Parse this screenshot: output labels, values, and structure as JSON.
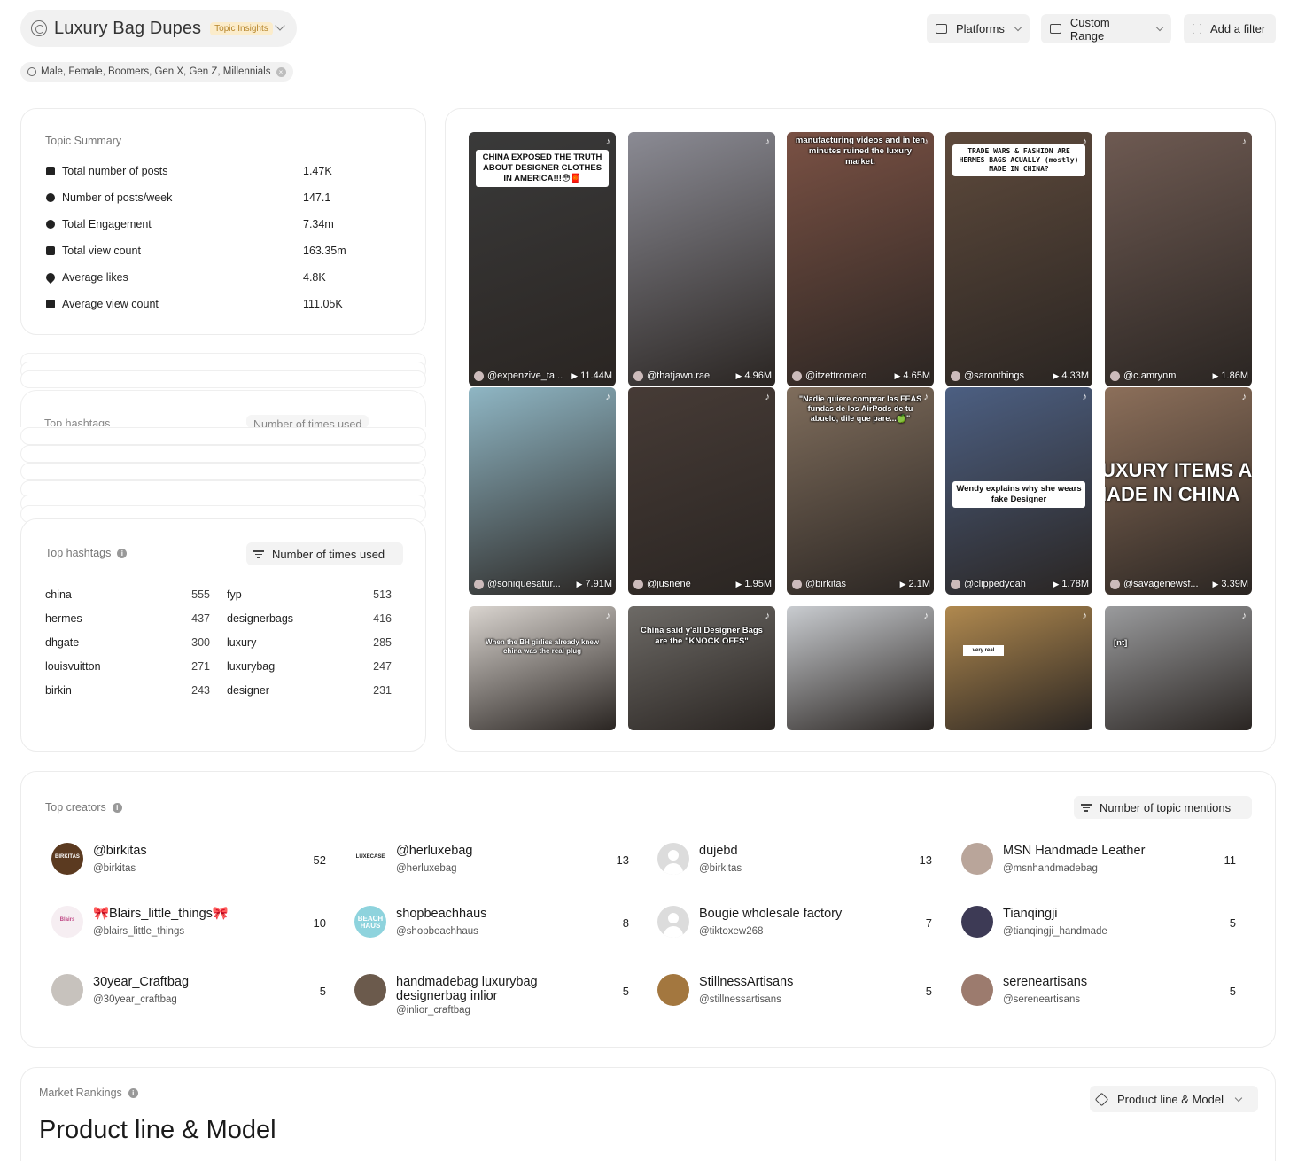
{
  "header": {
    "topic_title": "Luxury Bag Dupes",
    "topic_badge": "Topic Insights",
    "demographics": "Male, Female, Boomers, Gen X, Gen Z, Millennials",
    "buttons": {
      "platforms": "Platforms",
      "range": "Custom Range",
      "filter": "Add a filter"
    }
  },
  "summary": {
    "label": "Topic Summary",
    "rows": [
      {
        "label": "Total number of posts",
        "value": "1.47K"
      },
      {
        "label": "Number of posts/week",
        "value": "147.1"
      },
      {
        "label": "Total Engagement",
        "value": "7.34m"
      },
      {
        "label": "Total view count",
        "value": "163.35m"
      },
      {
        "label": "Average likes",
        "value": "4.8K"
      },
      {
        "label": "Average view count",
        "value": "111.05K"
      }
    ]
  },
  "hashtags": {
    "label": "Top hashtags",
    "sort_label": "Number of times used",
    "items": [
      {
        "tag": "china",
        "count": "555"
      },
      {
        "tag": "fyp",
        "count": "513"
      },
      {
        "tag": "hermes",
        "count": "437"
      },
      {
        "tag": "designerbags",
        "count": "416"
      },
      {
        "tag": "dhgate",
        "count": "300"
      },
      {
        "tag": "luxury",
        "count": "285"
      },
      {
        "tag": "louisvuitton",
        "count": "271"
      },
      {
        "tag": "luxurybag",
        "count": "247"
      },
      {
        "tag": "birkin",
        "count": "243"
      },
      {
        "tag": "designer",
        "count": "231"
      }
    ]
  },
  "videos": [
    {
      "handle": "@expenzive_ta...",
      "views": "11.44M",
      "caption": "CHINA EXPOSED THE TRUTH ABOUT DESIGNER CLOTHES IN AMERICA!!!😳🧧",
      "bg": "#3a3a3a"
    },
    {
      "handle": "@thatjawn.rae",
      "views": "4.96M",
      "caption": "",
      "bg": "#8b8b94"
    },
    {
      "handle": "@itzettromero",
      "views": "4.65M",
      "caption": "manufacturing videos and in ten minutes ruined the luxury market.",
      "bg": "#7a5144"
    },
    {
      "handle": "@saronthings",
      "views": "4.33M",
      "caption": "TRADE WARS & FASHION ARE HERMES BAGS ACUALLY (mostly) MADE IN CHINA?",
      "bg": "#5e4a3c"
    },
    {
      "handle": "@c.amrynm",
      "views": "1.86M",
      "caption": "",
      "bg": "#6e5a52"
    },
    {
      "handle": "@soniquesatur...",
      "views": "7.91M",
      "caption": "",
      "bg": "#8fb6c4"
    },
    {
      "handle": "@jusnene",
      "views": "1.95M",
      "caption": "",
      "bg": "#463b36"
    },
    {
      "handle": "@birkitas",
      "views": "2.1M",
      "caption": "\"Nadie quiere comprar las FEAS fundas de los AirPods de tu abuelo, dile que pare...🍏\"",
      "bg": "#7f6d5c"
    },
    {
      "handle": "@clippedyoah",
      "views": "1.78M",
      "caption": "Wendy explains why she wears fake Designer",
      "bg": "#4c5f82"
    },
    {
      "handle": "@savagenewsf...",
      "views": "3.39M",
      "caption": "UXURY ITEMS A\nIADE IN CHINA",
      "bg": "#8c6f5a"
    },
    {
      "handle": "",
      "views": "",
      "caption": "When the BH girlies already knew china was the real plug",
      "bg": "#d9d4cf"
    },
    {
      "handle": "",
      "views": "",
      "caption": "China said y'all Designer Bags are the \"KNOCK OFFS\"",
      "bg": "#6d6a66"
    },
    {
      "handle": "",
      "views": "",
      "caption": "",
      "bg": "#c9ccd0"
    },
    {
      "handle": "",
      "views": "",
      "caption": "very real",
      "bg": "#b0894f"
    },
    {
      "handle": "",
      "views": "",
      "caption": "[nt]",
      "bg": "#9a9b9d"
    }
  ],
  "creators": {
    "label": "Top creators",
    "sort_label": "Number of topic mentions",
    "items": [
      {
        "name": "@birkitas",
        "handle": "@birkitas",
        "count": "52",
        "avatar": "#5b3a20",
        "avatar_text": "BIRKITAS"
      },
      {
        "name": "@herluxebag",
        "handle": "@herluxebag",
        "count": "13",
        "avatar": "#ffffff",
        "avatar_text": "LUXECASE"
      },
      {
        "name": "dujebd",
        "handle": "@birkitas",
        "count": "13",
        "avatar": "",
        "avatar_text": ""
      },
      {
        "name": "MSN Handmade Leather",
        "handle": "@msnhandmadebag",
        "count": "11",
        "avatar": "#b9a59a",
        "avatar_text": ""
      },
      {
        "name": "🎀Blairs_little_things🎀",
        "handle": "@blairs_little_things",
        "count": "10",
        "avatar": "#f6eef2",
        "avatar_text": "Blairs"
      },
      {
        "name": "shopbeachhaus",
        "handle": "@shopbeachhaus",
        "count": "8",
        "avatar": "#8ed3dd",
        "avatar_text": "BEACH HAUS"
      },
      {
        "name": "Bougie wholesale factory",
        "handle": "@tiktoxew268",
        "count": "7",
        "avatar": "",
        "avatar_text": ""
      },
      {
        "name": "Tianqingji",
        "handle": "@tianqingji_handmade",
        "count": "5",
        "avatar": "#3d3a55",
        "avatar_text": ""
      },
      {
        "name": "30year_Craftbag",
        "handle": "@30year_craftbag",
        "count": "5",
        "avatar": "#c7c2bd",
        "avatar_text": ""
      },
      {
        "name": "handmadebag luxurybag designerbag inlior",
        "handle": "@inlior_craftbag",
        "count": "5",
        "avatar": "#6b5a4c",
        "avatar_text": ""
      },
      {
        "name": "StillnessArtisans",
        "handle": "@stillnessartisans",
        "count": "5",
        "avatar": "#a3773f",
        "avatar_text": ""
      },
      {
        "name": "sereneartisans",
        "handle": "@sereneartisans",
        "count": "5",
        "avatar": "#9c7b6e",
        "avatar_text": ""
      }
    ]
  },
  "market": {
    "label": "Market Rankings",
    "title": "Product line & Model",
    "dropdown": "Product line & Model"
  }
}
